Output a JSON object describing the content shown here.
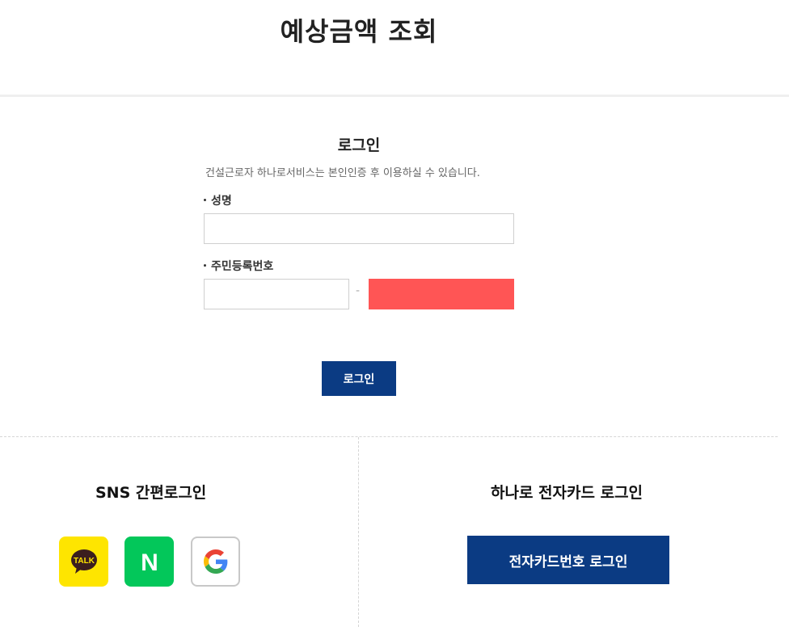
{
  "page": {
    "title": "예상금액 조회"
  },
  "login": {
    "title": "로그인",
    "description": "건설근로자 하나로서비스는 본인인증 후 이용하실 수 있습니다.",
    "name_label": "성명",
    "name_value": "",
    "rrn_label": "주민등록번호",
    "rrn_front_value": "",
    "rrn_separator": "-",
    "rrn_back_value": "",
    "button_label": "로그인"
  },
  "sns": {
    "title": "SNS 간편로그인",
    "buttons": [
      {
        "name": "kakao",
        "icon": "kakao-talk-icon",
        "text": "TALK",
        "color": "#fee500"
      },
      {
        "name": "naver",
        "icon": "naver-icon",
        "text": "N",
        "color": "#03c75a"
      },
      {
        "name": "google",
        "icon": "google-icon",
        "color": "#ffffff"
      }
    ]
  },
  "card": {
    "title": "하나로 전자카드 로그인",
    "button_label": "전자카드번호 로그인"
  },
  "colors": {
    "primary": "#0b3b83",
    "masked_field": "#ff5555"
  }
}
